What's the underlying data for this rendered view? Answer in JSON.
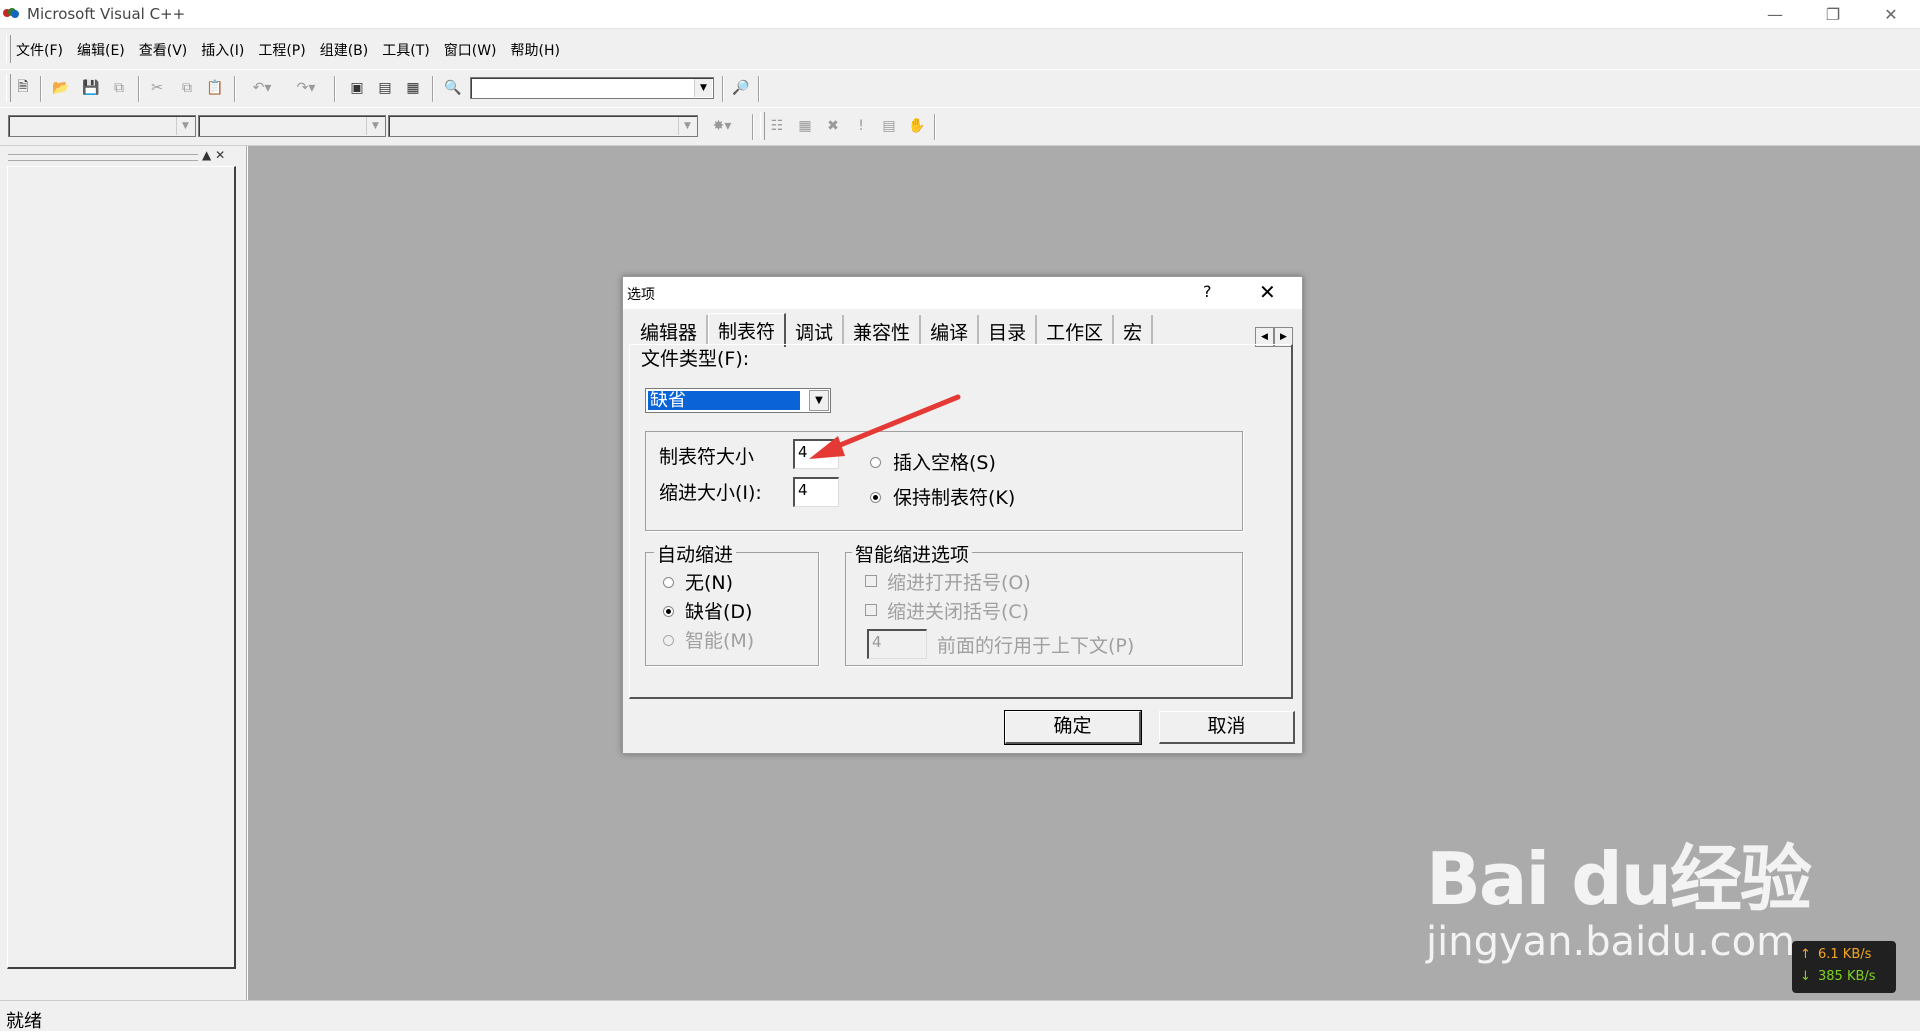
{
  "app": {
    "title": "Microsoft Visual C++"
  },
  "menu": [
    "文件(F)",
    "编辑(E)",
    "查看(V)",
    "插入(I)",
    "工程(P)",
    "组建(B)",
    "工具(T)",
    "窗口(W)",
    "帮助(H)"
  ],
  "status": {
    "text": "就绪"
  },
  "dialog": {
    "title": "选项",
    "help_glyph": "?",
    "close_glyph": "✕",
    "tabs": [
      "编辑器",
      "制表符",
      "调试",
      "兼容性",
      "编译",
      "目录",
      "工作区",
      "宏"
    ],
    "active_tab": "制表符",
    "file_type": {
      "label": "文件类型(F):",
      "value": "缺省"
    },
    "tab_size": {
      "label": "制表符大小",
      "value": "4"
    },
    "indent_size": {
      "label": "缩进大小(I):",
      "value": "4"
    },
    "insert_spaces": {
      "label": "插入空格(S)",
      "selected": false
    },
    "keep_tabs": {
      "label": "保持制表符(K)",
      "selected": true
    },
    "auto_indent": {
      "title": "自动缩进",
      "none": "无(N)",
      "default": "缺省(D)",
      "smart": "智能(M)",
      "selected": "default"
    },
    "smart_indent": {
      "title": "智能缩进选项",
      "indent_open": "缩进打开括号(O)",
      "indent_close": "缩进关闭括号(C)",
      "context_value": "4",
      "context_label": "前面的行用于上下文(P)"
    },
    "ok": "确定",
    "cancel": "取消"
  },
  "watermark": {
    "brand": "Bai du经验",
    "url": "jingyan.baidu.com"
  },
  "net_speed": {
    "up": "6.1 KB/s",
    "down": "385 KB/s"
  },
  "colors": {
    "mdi_background": "#ababab",
    "selection": "#0a64d8",
    "arrow_annotation": "#e53935"
  }
}
